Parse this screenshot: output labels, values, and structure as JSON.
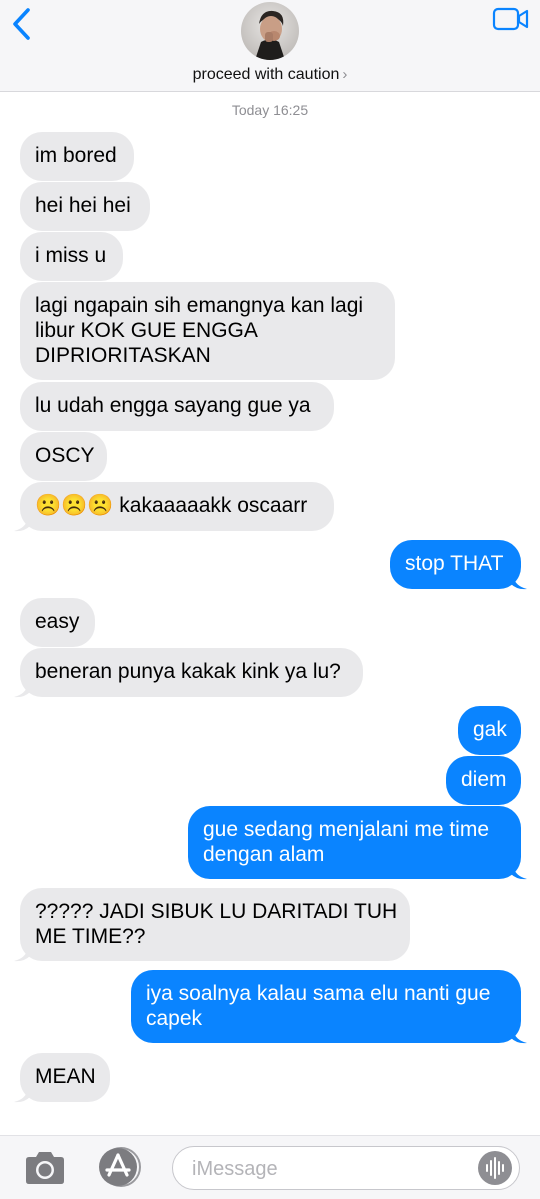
{
  "header": {
    "contact_name": "proceed with caution",
    "chevron": "›",
    "back_icon": "chevron-left-icon",
    "video_icon": "video-camera-icon",
    "accent_color": "#0a84ff"
  },
  "timestamp": "Today 16:25",
  "messages": [
    {
      "direction": "incoming",
      "text": "im bored"
    },
    {
      "direction": "incoming",
      "text": "hei hei hei"
    },
    {
      "direction": "incoming",
      "text": "i miss u"
    },
    {
      "direction": "incoming",
      "lines": [
        "lagi ngapain sih emangnya kan lagi",
        "libur KOK GUE ENGGA",
        "DIPRIORITASKAN"
      ]
    },
    {
      "direction": "incoming",
      "text": "lu udah engga sayang gue ya"
    },
    {
      "direction": "incoming",
      "text": "OSCY"
    },
    {
      "direction": "incoming",
      "emoji": "☹️☹️☹️",
      "text": "kakaaaaakk oscaarr"
    },
    {
      "direction": "outgoing",
      "text": "stop THAT"
    },
    {
      "direction": "incoming",
      "text": "easy"
    },
    {
      "direction": "incoming",
      "text": "beneran punya kakak kink ya lu?"
    },
    {
      "direction": "outgoing",
      "text": "gak"
    },
    {
      "direction": "outgoing",
      "text": "diem"
    },
    {
      "direction": "outgoing",
      "lines": [
        "gue sedang menjalani me time",
        "dengan alam"
      ]
    },
    {
      "direction": "incoming",
      "lines": [
        "????? JADI SIBUK LU DARITADI TUH",
        "ME TIME??"
      ]
    },
    {
      "direction": "outgoing",
      "lines": [
        "iya soalnya kalau sama elu nanti gue",
        "capek"
      ]
    },
    {
      "direction": "incoming",
      "text": "MEAN"
    }
  ],
  "composer": {
    "placeholder": "iMessage",
    "value": "",
    "camera_icon": "camera-icon",
    "apps_icon": "app-store-icon",
    "audio_icon": "audio-waveform-icon"
  }
}
